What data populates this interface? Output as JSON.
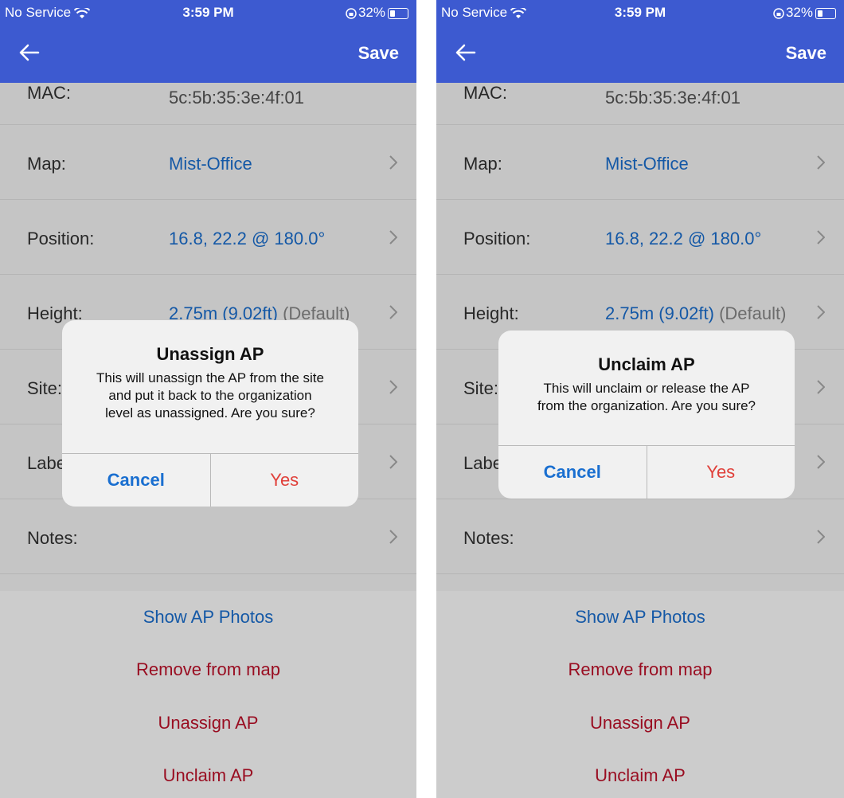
{
  "status": {
    "carrier": "No Service",
    "time": "3:59 PM",
    "battery": "32%"
  },
  "nav": {
    "save_label": "Save"
  },
  "fields": {
    "mac": {
      "label": "MAC:",
      "value": "5c:5b:35:3e:4f:01"
    },
    "map": {
      "label": "Map:",
      "value": "Mist-Office"
    },
    "position": {
      "label": "Position:",
      "value": "16.8, 22.2 @ 180.0°"
    },
    "height": {
      "label": "Height:",
      "value": "2.75m (9.02ft)",
      "note": "(Default)"
    },
    "site": {
      "label": "Site:"
    },
    "labels": {
      "label": "Labe"
    },
    "notes": {
      "label": "Notes:"
    }
  },
  "actions": {
    "show_photos": "Show AP Photos",
    "remove_from_map": "Remove from map",
    "unassign": "Unassign AP",
    "unclaim": "Unclaim AP"
  },
  "dialogs": {
    "unassign": {
      "title": "Unassign AP",
      "line1": "This will unassign the AP from the site",
      "line2": "and put it back to the organization",
      "line3": "level as unassigned. Are you sure?",
      "cancel": "Cancel",
      "confirm": "Yes"
    },
    "unclaim": {
      "title": "Unclaim AP",
      "line1": "This will unclaim or release the AP",
      "line2": "from the organization. Are you sure?",
      "cancel": "Cancel",
      "confirm": "Yes"
    }
  },
  "colors": {
    "header": "#3d5ad0",
    "link": "#1a6fd0",
    "destructive": "#c0112a",
    "confirm": "#e0403a"
  }
}
